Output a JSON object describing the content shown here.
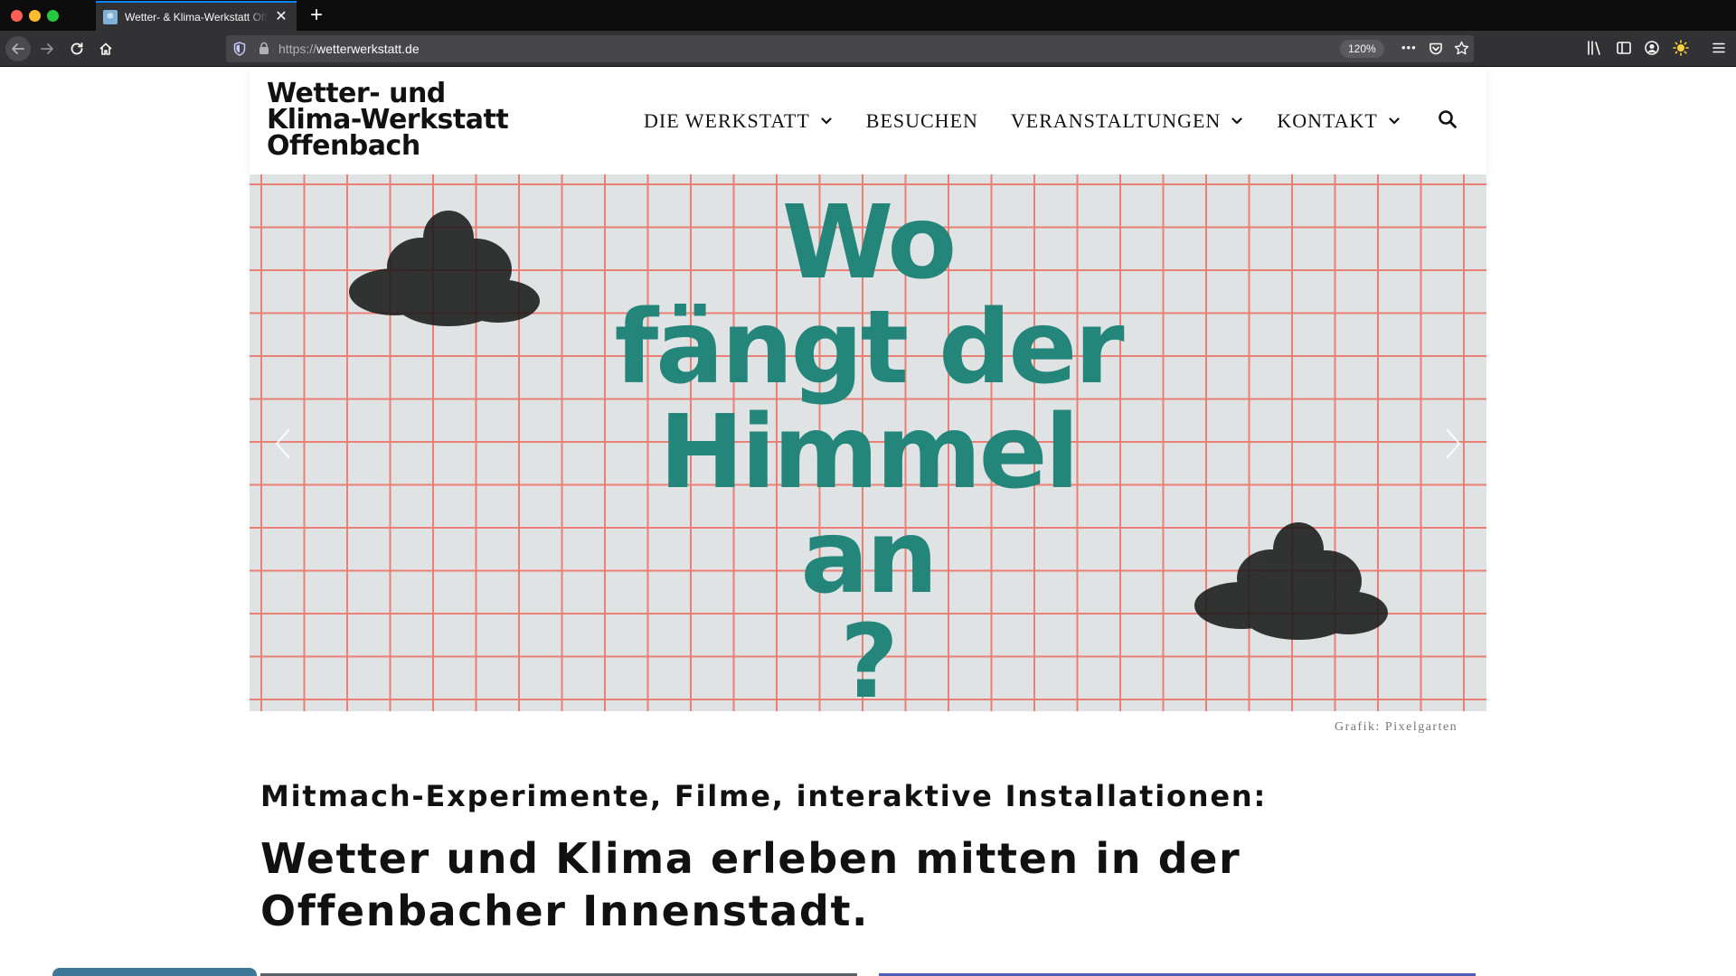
{
  "browser": {
    "tab_title": "Wetter- & Klima-Werkstatt Offenbach",
    "tab_close": "✕",
    "new_tab": "+",
    "url_scheme": "https://",
    "url_host": "wetterwerkstatt.de",
    "zoom": "120%",
    "more": "•••"
  },
  "site": {
    "logo": [
      "Wetter- und",
      "Klima-Werkstatt",
      "Offenbach"
    ],
    "nav": [
      {
        "label": "DIE WERKSTATT",
        "dropdown": true
      },
      {
        "label": "BESUCHEN",
        "dropdown": false
      },
      {
        "label": "VERANSTALTUNGEN",
        "dropdown": true
      },
      {
        "label": "KONTAKT",
        "dropdown": true
      }
    ]
  },
  "hero": {
    "headline_lines": [
      "Wo",
      "fängt der",
      "Himmel",
      "an",
      "?"
    ],
    "text_color": "#24857b",
    "grid_color": "#ea7f76",
    "background": "#dfe3e3",
    "credit": "Grafik: Pixelgarten"
  },
  "intro": {
    "subhead": "Mitmach-Experimente, Filme, interaktive Installationen:",
    "headline_lines": [
      "Wetter und Klima erleben mitten in der",
      "Offenbacher Innenstadt."
    ]
  }
}
